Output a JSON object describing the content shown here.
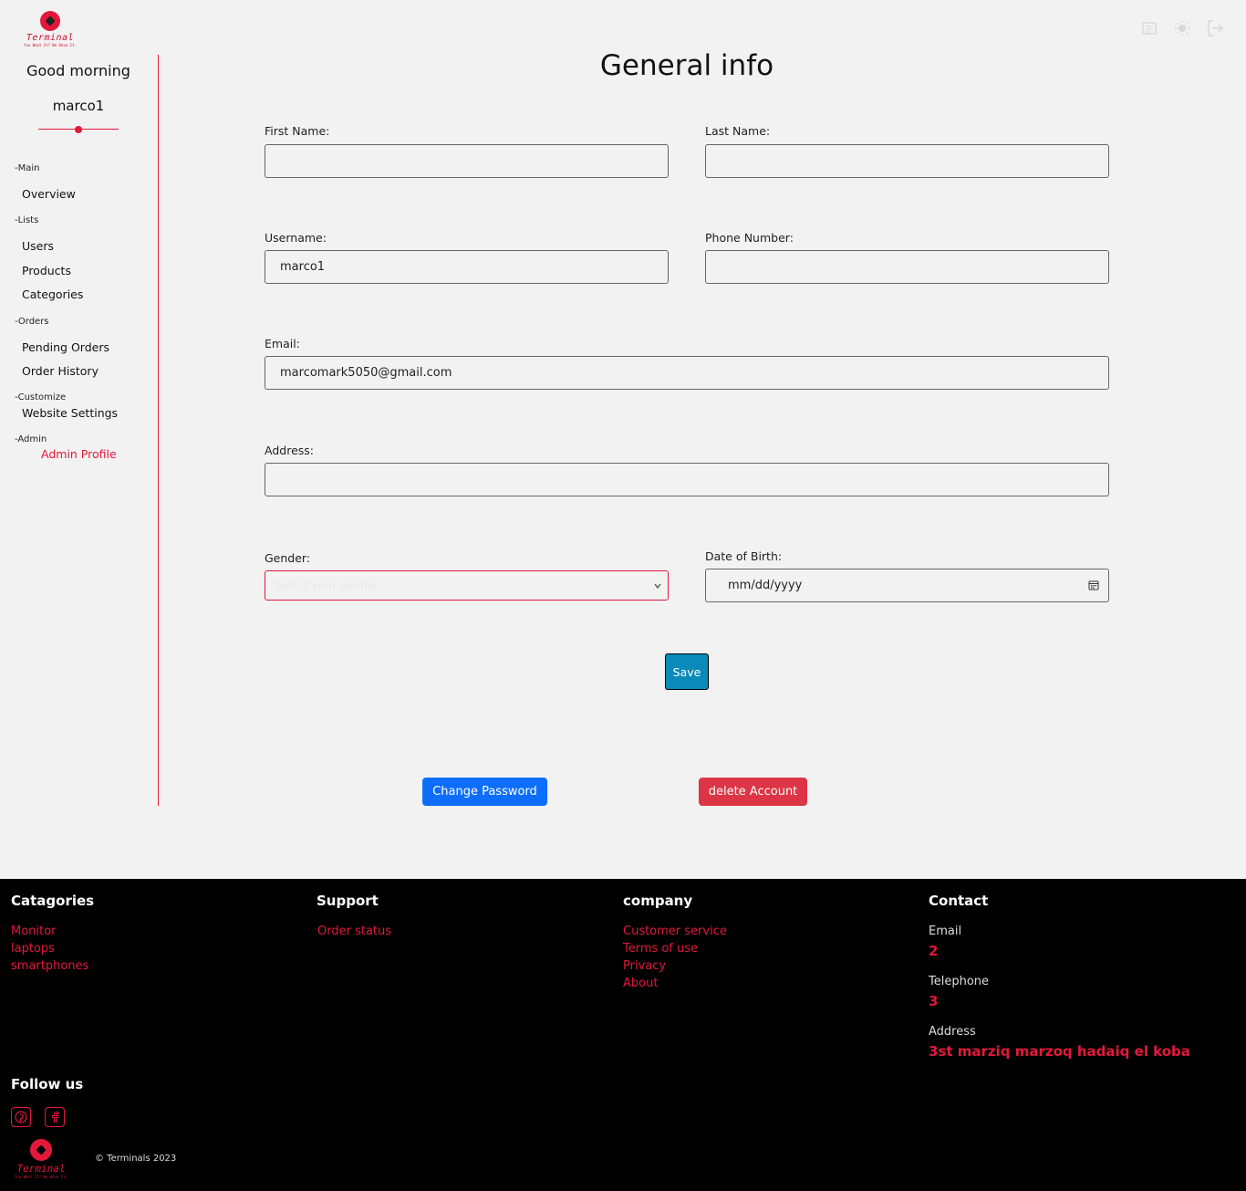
{
  "brand": {
    "name": "Terminal",
    "tagline": "You Want It? We Have It."
  },
  "top_icons": [
    "settings-icon",
    "sun-icon",
    "logout-icon"
  ],
  "sidebar": {
    "greeting": "Good morning",
    "username": "marco1",
    "sections": [
      {
        "label": "-Main",
        "items": [
          "Overview"
        ]
      },
      {
        "label": "-Lists",
        "items": [
          "Users",
          "Products",
          "Categories"
        ]
      },
      {
        "label": "-Orders",
        "items": [
          "Pending Orders",
          "Order History"
        ]
      },
      {
        "label": "-Customize",
        "items": [
          "Website Settings"
        ]
      },
      {
        "label": "-Admin",
        "items": [
          "Admin Profile"
        ]
      }
    ],
    "active_item": "Admin Profile"
  },
  "form": {
    "title": "General info",
    "first_name": {
      "label": "First Name:",
      "value": ""
    },
    "last_name": {
      "label": "Last Name:",
      "value": ""
    },
    "username": {
      "label": "Username:",
      "value": "marco1"
    },
    "phone": {
      "label": "Phone Number:",
      "value": ""
    },
    "email": {
      "label": "Email:",
      "value": "marcomark5050@gmail.com"
    },
    "address": {
      "label": "Address:",
      "value": ""
    },
    "gender": {
      "label": "Gender:",
      "placeholder": "Select your gender"
    },
    "dob": {
      "label": "Date of Birth:",
      "placeholder": "mm/dd/yyyy"
    },
    "save_label": "Save",
    "change_password_label": "Change Password",
    "delete_account_label": "delete Account"
  },
  "footer": {
    "categories": {
      "heading": "Catagories",
      "links": [
        "Monitor",
        "laptops",
        "smartphones"
      ]
    },
    "support": {
      "heading": "Support",
      "links": [
        "Order status"
      ]
    },
    "company": {
      "heading": "company",
      "links": [
        "Customer service",
        "Terms of use",
        "Privacy",
        "About"
      ]
    },
    "contact": {
      "heading": "Contact",
      "email_label": "Email",
      "email_value": "2",
      "telephone_label": "Telephone",
      "telephone_value": "3",
      "address_label": "Address",
      "address_value": "3st marziq marzoq hadaiq el koba"
    },
    "follow_heading": "Follow us",
    "social": [
      "pinterest-icon",
      "facebook-icon"
    ],
    "copyright": "© Terminals 2023"
  },
  "colors": {
    "accent": "#e3183a",
    "save": "#0a8ab8",
    "primary": "#0d6efd",
    "danger": "#dc3545"
  }
}
